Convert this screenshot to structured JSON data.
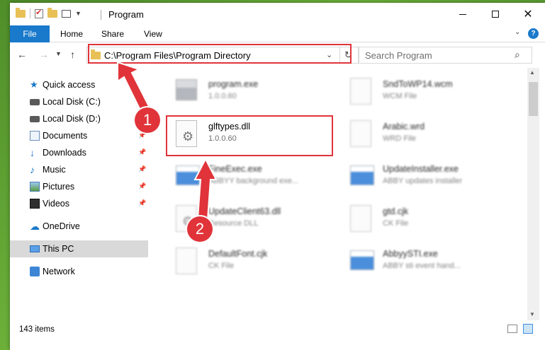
{
  "window": {
    "title": "Program",
    "controls": {
      "min": "minimize",
      "max": "maximize",
      "close": "✕"
    }
  },
  "ribbon": {
    "tabs": [
      "File",
      "Home",
      "Share",
      "View"
    ],
    "help": "?"
  },
  "address": {
    "path": "C:\\Program Files\\Program Directory",
    "refresh": "↻"
  },
  "search": {
    "placeholder": "Search Program"
  },
  "sidebar": {
    "items": [
      {
        "label": "Quick access",
        "icon": "star-icon"
      },
      {
        "label": "Local Disk (C:)",
        "icon": "disk-icon"
      },
      {
        "label": "Local Disk (D:)",
        "icon": "disk-icon"
      },
      {
        "label": "Documents",
        "icon": "document-icon"
      },
      {
        "label": "Downloads",
        "icon": "download-icon"
      },
      {
        "label": "Music",
        "icon": "music-icon"
      },
      {
        "label": "Pictures",
        "icon": "pictures-icon"
      },
      {
        "label": "Videos",
        "icon": "video-icon"
      },
      {
        "label": "OneDrive",
        "icon": "cloud-icon"
      },
      {
        "label": "This PC",
        "icon": "computer-icon"
      },
      {
        "label": "Network",
        "icon": "network-icon"
      }
    ]
  },
  "files": [
    {
      "name": "program.exe",
      "sub": "1.0.0.60"
    },
    {
      "name": "SndToWP14.wcm",
      "sub": "WCM File"
    },
    {
      "name": "glftypes.dll",
      "sub": "1.0.0.60"
    },
    {
      "name": "Arabic.wrd",
      "sub": "WRD File"
    },
    {
      "name": "FineExec.exe",
      "sub": "ABBYY background exe..."
    },
    {
      "name": "UpdateInstaller.exe",
      "sub": "ABBY updates installer"
    },
    {
      "name": "UpdateClient63.dll",
      "sub": "Resource DLL"
    },
    {
      "name": "gtd.cjk",
      "sub": "CK File"
    },
    {
      "name": "DefaultFont.cjk",
      "sub": "CK File"
    },
    {
      "name": "AbbyySTI.exe",
      "sub": "ABBY sti event hand..."
    }
  ],
  "status": {
    "items": "143 items"
  },
  "annotations": {
    "step1": "1",
    "step2": "2"
  },
  "colors": {
    "accent": "#1979ca",
    "highlight": "#e0343a",
    "selected": "#d9d9d9"
  }
}
